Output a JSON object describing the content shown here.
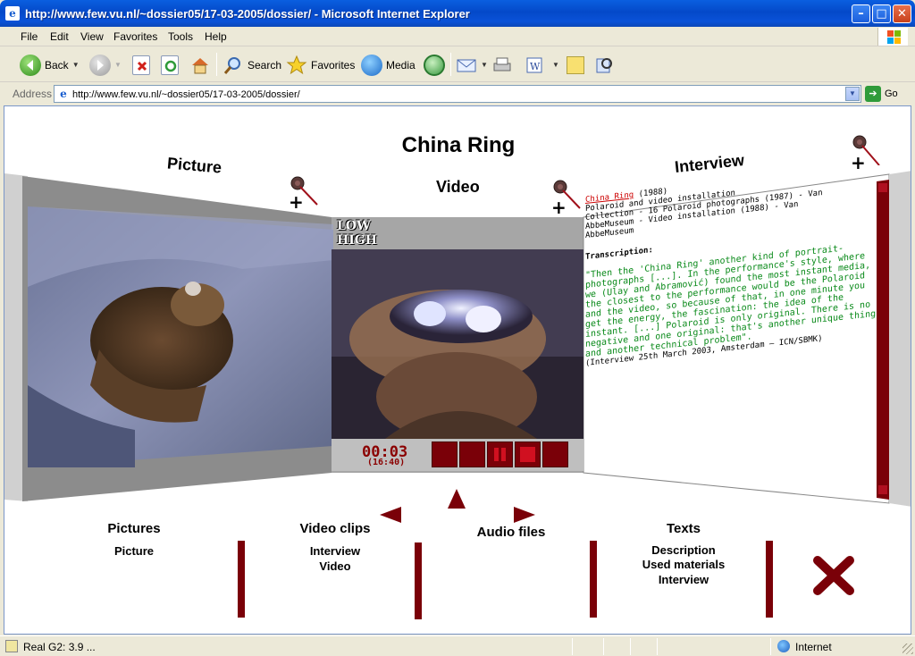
{
  "window": {
    "title": "http://www.few.vu.nl/~dossier05/17-03-2005/dossier/ - Microsoft Internet Explorer",
    "controls": [
      "minimize",
      "maximize",
      "close"
    ]
  },
  "menu": [
    "File",
    "Edit",
    "View",
    "Favorites",
    "Tools",
    "Help"
  ],
  "toolbar": {
    "back": "Back",
    "search": "Search",
    "favorites": "Favorites",
    "media": "Media"
  },
  "address": {
    "label": "Address",
    "url": "http://www.few.vu.nl/~dossier05/17-03-2005/dossier/",
    "go": "Go"
  },
  "page": {
    "title": "China Ring",
    "panels": {
      "picture": "Picture",
      "video": "Video",
      "interview": "Interview"
    },
    "plus": "+",
    "video": {
      "low": "LOW",
      "high": "HIGH",
      "time": "00:03",
      "duration": "(16:40)"
    },
    "interview_text": {
      "title_link": "China Ring",
      "year": "(1988)",
      "line1": "Polaroid and video installation",
      "line2": "Collection - 16 Polaroid photographs (1987) - Van",
      "line3": "AbbeMuseum - Video installation (1988) - Van",
      "line4": "AbbeMuseum",
      "transcription_label": "Transcription:",
      "quote": "\"Then the 'China Ring' another kind of portrait-photographs [...]. In the performance's style, where we (Ulay and Abramović) found the most instant media, the closest to the performance would be the Polaroid and the video, so because of that, in one minute you get the energy, the fascination: the idea of the instant. [...] Polaroid is only original. There is no negative and one original: that's another unique thing and another technical problem\".",
      "source": "(Interview 25th March 2003, Amsterdam — ICN/SBMK)"
    },
    "nav": {
      "pictures": {
        "heading": "Pictures",
        "items": [
          "Picture"
        ]
      },
      "video_clips": {
        "heading": "Video clips",
        "items": [
          "Interview",
          "Video"
        ]
      },
      "audio": {
        "heading": "Audio files"
      },
      "texts": {
        "heading": "Texts",
        "items": [
          "Description",
          "Used materials",
          "Interview"
        ]
      }
    },
    "close_symbol": "✖"
  },
  "status": {
    "text": "Real G2: 3.9 ...",
    "zone": "Internet"
  },
  "colors": {
    "accent": "#7a0008",
    "xp_title": "#0a52d8",
    "quote_green": "#0a8a1a"
  }
}
